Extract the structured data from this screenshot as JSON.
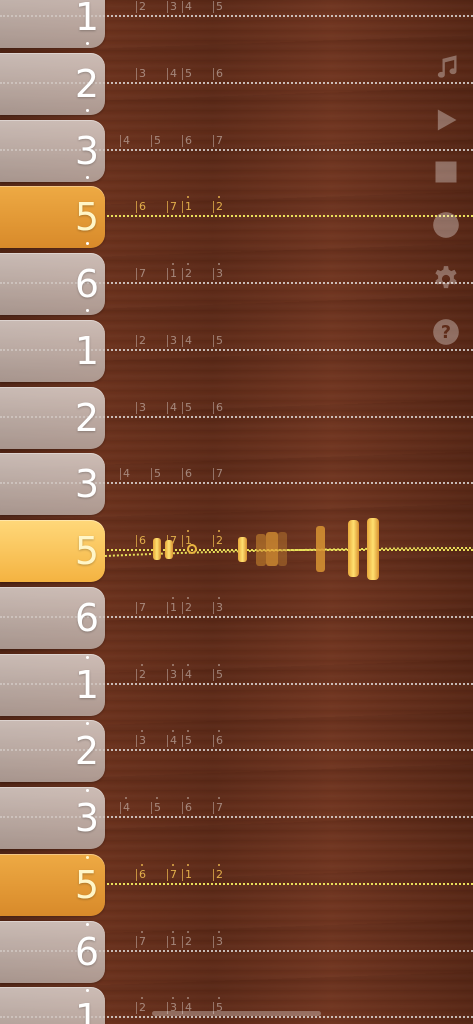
{
  "rows": [
    {
      "note": "1",
      "dot": "bottom",
      "style": "normal",
      "frets": [
        "2",
        "3",
        "4",
        "5"
      ],
      "fret_dots": []
    },
    {
      "note": "2",
      "dot": "bottom",
      "style": "normal",
      "frets": [
        "3",
        "4",
        "5",
        "6"
      ],
      "fret_dots": []
    },
    {
      "note": "3",
      "dot": "bottom",
      "style": "normal",
      "frets": [
        "4",
        "5",
        "6",
        "7"
      ],
      "fret_dots": []
    },
    {
      "note": "5",
      "dot": "bottom",
      "style": "gold",
      "frets": [
        "6",
        "7",
        "1",
        "2"
      ],
      "fret_dots": [
        2,
        3
      ]
    },
    {
      "note": "6",
      "dot": "bottom",
      "style": "normal",
      "frets": [
        "7",
        "1",
        "2",
        "3"
      ],
      "fret_dots": [
        1,
        2,
        3
      ]
    },
    {
      "note": "1",
      "dot": "none",
      "style": "normal",
      "frets": [
        "2",
        "3",
        "4",
        "5"
      ],
      "fret_dots": []
    },
    {
      "note": "2",
      "dot": "none",
      "style": "normal",
      "frets": [
        "3",
        "4",
        "5",
        "6"
      ],
      "fret_dots": []
    },
    {
      "note": "3",
      "dot": "none",
      "style": "normal",
      "frets": [
        "4",
        "5",
        "6",
        "7"
      ],
      "fret_dots": []
    },
    {
      "note": "5",
      "dot": "none",
      "style": "gold-bright",
      "frets": [
        "6",
        "7",
        "1",
        "2"
      ],
      "fret_dots": [
        2,
        3
      ]
    },
    {
      "note": "6",
      "dot": "none",
      "style": "normal",
      "frets": [
        "7",
        "1",
        "2",
        "3"
      ],
      "fret_dots": [
        1,
        2,
        3
      ]
    },
    {
      "note": "1",
      "dot": "top",
      "style": "normal",
      "frets": [
        "2",
        "3",
        "4",
        "5"
      ],
      "fret_dots": [
        0,
        1,
        2,
        3
      ]
    },
    {
      "note": "2",
      "dot": "top",
      "style": "normal",
      "frets": [
        "3",
        "4",
        "5",
        "6"
      ],
      "fret_dots": [
        0,
        1,
        2,
        3
      ]
    },
    {
      "note": "3",
      "dot": "top",
      "style": "normal",
      "frets": [
        "4",
        "5",
        "6",
        "7"
      ],
      "fret_dots": [
        0,
        1,
        2,
        3
      ]
    },
    {
      "note": "5",
      "dot": "top",
      "style": "gold",
      "frets": [
        "6",
        "7",
        "1",
        "2"
      ],
      "fret_dots": [
        0,
        1,
        2,
        3
      ]
    },
    {
      "note": "6",
      "dot": "top",
      "style": "normal",
      "frets": [
        "7",
        "1",
        "2",
        "3"
      ],
      "fret_dots": [
        0,
        1,
        2,
        3
      ]
    },
    {
      "note": "1",
      "dot": "top",
      "style": "normal",
      "frets": [
        "2",
        "3",
        "4",
        "5"
      ],
      "fret_dots": [
        0,
        1,
        2,
        3
      ]
    }
  ],
  "toolbar": {
    "items": [
      {
        "name": "music-note-icon"
      },
      {
        "name": "play-icon"
      },
      {
        "name": "stop-icon"
      },
      {
        "name": "record-icon"
      },
      {
        "name": "gear-icon"
      },
      {
        "name": "help-icon",
        "label": "?"
      }
    ]
  },
  "colors": {
    "wood": "#5f2c19",
    "key": "#d0c4be",
    "gold": "#e39a36",
    "gold_bright": "#ffcc5c",
    "gold_string": "#e9e05a",
    "white_string": "#e8e8e8",
    "icon": "#ffffff"
  }
}
